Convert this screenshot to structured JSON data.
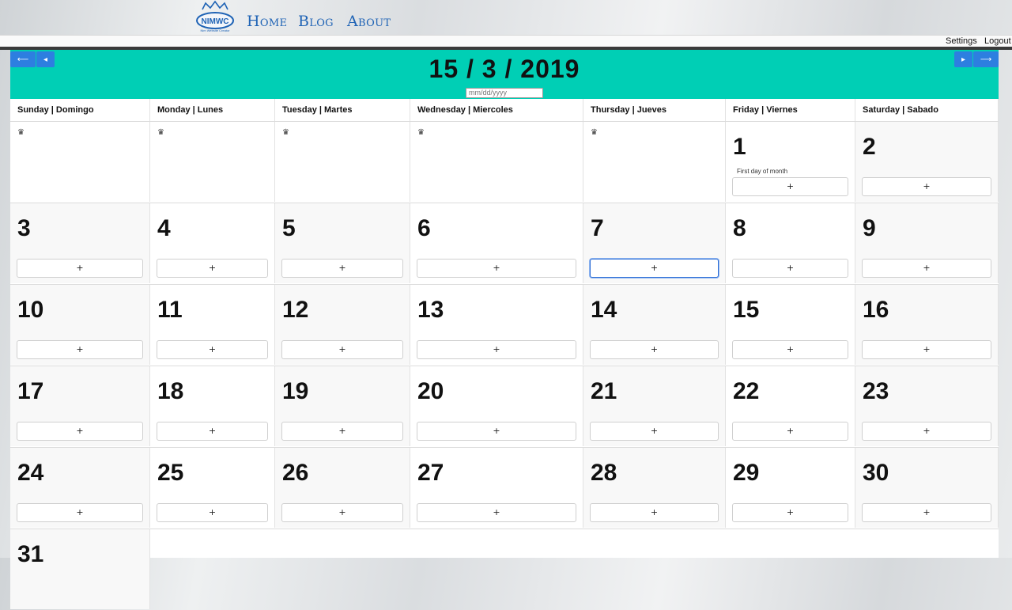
{
  "nav": {
    "home": "Home",
    "blog": "Blog",
    "about": "About"
  },
  "logo": {
    "text": "NIMWC",
    "subtitle": "Nim Website Creator"
  },
  "util": {
    "settings": "Settings",
    "logout": "Logout"
  },
  "calendar": {
    "title": "15 / 3 / 2019",
    "date_placeholder": "mm/dd/yyyy",
    "weekdays": [
      "Sunday | Domingo",
      "Monday | Lunes",
      "Tuesday | Martes",
      "Wednesday | Miercoles",
      "Thursday | Jueves",
      "Friday | Viernes",
      "Saturday | Sabado"
    ],
    "first_day_note": "First day of month",
    "add_label": "+",
    "empty_icon": "♛",
    "weeks": [
      [
        "",
        "",
        "",
        "",
        "",
        "1",
        "2"
      ],
      [
        "3",
        "4",
        "5",
        "6",
        "7",
        "8",
        "9"
      ],
      [
        "10",
        "11",
        "12",
        "13",
        "14",
        "15",
        "16"
      ],
      [
        "17",
        "18",
        "19",
        "20",
        "21",
        "22",
        "23"
      ],
      [
        "24",
        "25",
        "26",
        "27",
        "28",
        "29",
        "30"
      ],
      [
        "31"
      ]
    ]
  },
  "colors": {
    "header": "#00cfb5",
    "nav_link": "#1f63b5",
    "nav_button": "#2d7fe0"
  }
}
